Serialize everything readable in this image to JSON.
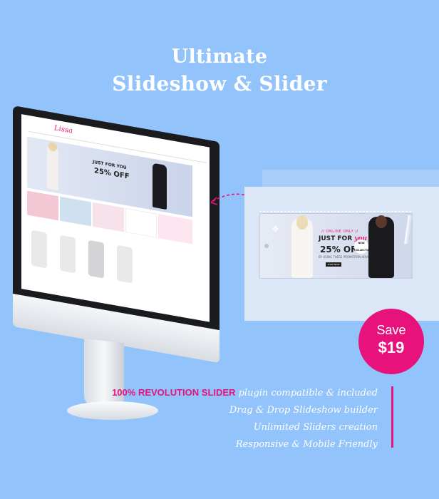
{
  "heading": {
    "line1": "Ultimate",
    "line2": "Slideshow & Slider"
  },
  "slider_preview": {
    "tag": "// ONLINE ONLY //",
    "headline_pre": "JUST FOR",
    "headline_accent": "you",
    "offer": "25% OFF",
    "subtext": "BY USING THESE PROMOTION ADVANCED CODE",
    "button": "SHOP NOW",
    "badge": "NEW COLLECTION"
  },
  "mini_site": {
    "logo": "Lissa",
    "banner_line1": "JUST FOR YOU",
    "banner_line2": "25% OFF"
  },
  "save_badge": {
    "line1": "Save",
    "line2": "$19"
  },
  "features": {
    "highlight": "100% REVOLUTION SLIDER",
    "first_rest": " plugin compatible & included",
    "items": [
      "Drag & Drop Slideshow builder",
      "Unlimited Sliders creation",
      "Responsive & Mobile Friendly"
    ]
  },
  "colors": {
    "background": "#93c3fb",
    "accent": "#e8127c",
    "panel": "#dbe6f6"
  },
  "icons": [
    "move-icon",
    "arrow-icon"
  ]
}
